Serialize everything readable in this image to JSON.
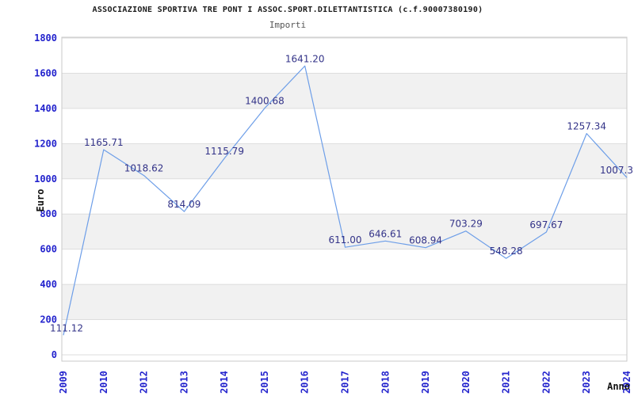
{
  "chart_data": {
    "type": "line",
    "title": "ASSOCIAZIONE SPORTIVA TRE PONT I ASSOC.SPORT.DILETTANTISTICA (c.f.90007380190)",
    "subtitle": "Importi",
    "xlabel": "Anno",
    "ylabel": "Euro",
    "categories": [
      "2009",
      "2010",
      "2012",
      "2013",
      "2014",
      "2015",
      "2016",
      "2017",
      "2018",
      "2019",
      "2020",
      "2021",
      "2022",
      "2023",
      "2024"
    ],
    "values": [
      111.12,
      1165.71,
      1018.62,
      814.09,
      1115.79,
      1400.68,
      1641.2,
      611.0,
      646.61,
      608.94,
      703.29,
      548.28,
      697.67,
      1257.34,
      1007.3
    ],
    "point_labels": [
      "111.12",
      "1165.71",
      "1018.62",
      "814.09",
      "1115.79",
      "1400.68",
      "1641.20",
      "611.00",
      "646.61",
      "608.94",
      "703.29",
      "548.28",
      "697.67",
      "1257.34",
      "1007.3"
    ],
    "ylim": [
      0,
      1800
    ],
    "ytick_step": 200,
    "ytick_labels": [
      "0",
      "200",
      "400",
      "600",
      "800",
      "1000",
      "1200",
      "1400",
      "1600",
      "1800"
    ],
    "grid": true,
    "legend": "none",
    "banding": "alternating horizontal bands every 200 units",
    "colors": {
      "line": "#6d9ee8",
      "tick_label": "#2323cd",
      "point_label": "#333388",
      "band": "#f1f1f1",
      "grid": "#dddddd",
      "border": "#c9c9c9",
      "title": "#1a1a1a",
      "subtitle": "#555555",
      "axis_title": "#111111",
      "background": "#ffffff"
    }
  }
}
